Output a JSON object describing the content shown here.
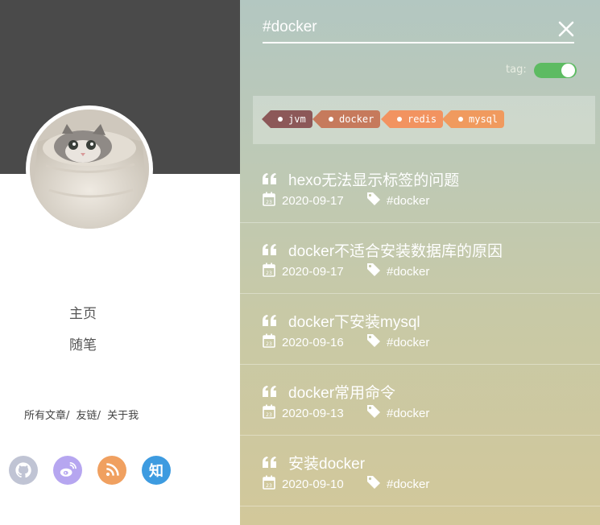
{
  "sidebar": {
    "nav": [
      {
        "label": "主页"
      },
      {
        "label": "随笔"
      }
    ],
    "links": [
      "所有文章",
      "友链",
      "关于我"
    ],
    "link_separator": "/",
    "social": [
      {
        "name": "github",
        "color": "#c0c4d4"
      },
      {
        "name": "weibo",
        "color": "#b6a6f0"
      },
      {
        "name": "rss",
        "color": "#f0a060"
      },
      {
        "name": "zhihu",
        "color": "#3d9be0",
        "text": "知"
      }
    ]
  },
  "search": {
    "value": "#docker",
    "tag_label": "tag:",
    "tag_toggle_on": true
  },
  "tags": [
    {
      "label": "jvm",
      "color": "#8c5858"
    },
    {
      "label": "docker",
      "color": "#c67a5c"
    },
    {
      "label": "redis",
      "color": "#f29360"
    },
    {
      "label": "mysql",
      "color": "#f09a5e"
    }
  ],
  "results": [
    {
      "title": "hexo无法显示标签的问题",
      "date": "2020-09-17",
      "tag": "#docker"
    },
    {
      "title": "docker不适合安装数据库的原因",
      "date": "2020-09-17",
      "tag": "#docker"
    },
    {
      "title": "docker下安装mysql",
      "date": "2020-09-16",
      "tag": "#docker"
    },
    {
      "title": "docker常用命令",
      "date": "2020-09-13",
      "tag": "#docker"
    },
    {
      "title": "安装docker",
      "date": "2020-09-10",
      "tag": "#docker"
    }
  ]
}
